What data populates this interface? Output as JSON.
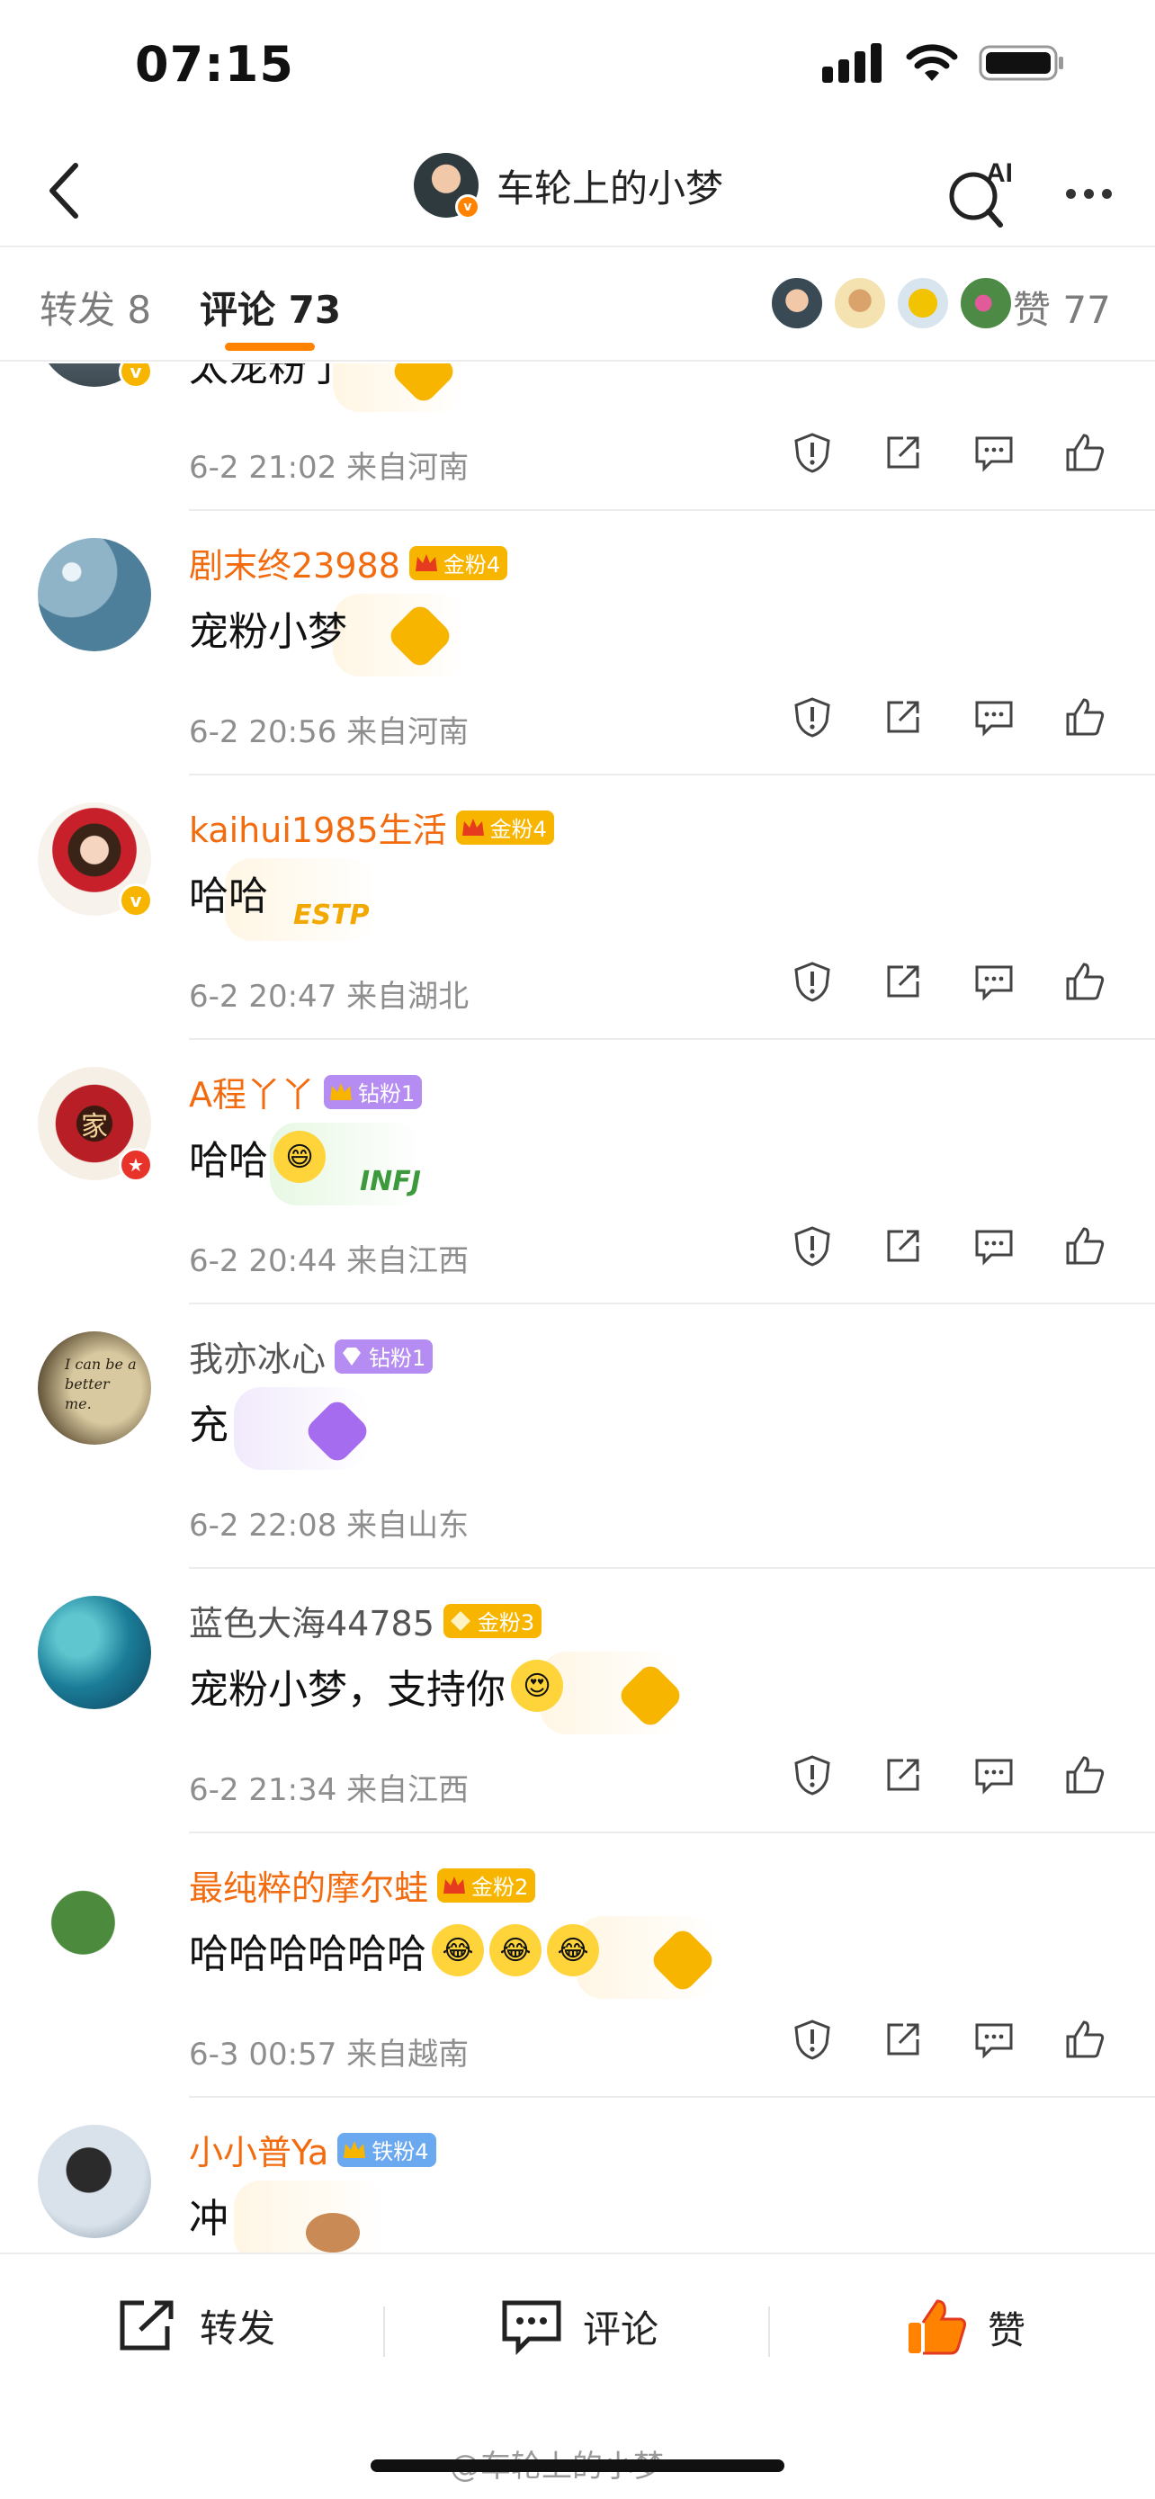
{
  "status_bar": {
    "time": "07:15"
  },
  "nav": {
    "title": "车轮上的小梦",
    "ai_label": "AI"
  },
  "tabs": {
    "repost": "转发 8",
    "comments": "评论 73",
    "likes": "赞 77"
  },
  "colors": {
    "accent": "#ff8200",
    "name_orange": "#f26b0f",
    "name_gray": "#555555",
    "gold_badge": "#f7b500",
    "diamond_badge": "#b58cf2",
    "iron_badge": "#6aa8f0",
    "meta_gray": "#8e8e8e"
  },
  "comments": [
    {
      "name": "",
      "text": "太宠粉了",
      "meta": "6-2 21:02  来自河南",
      "badge": "",
      "avatar": "partial-avatar"
    },
    {
      "name": "剧末终23988",
      "name_color": "orange",
      "badge": "金粉4",
      "badge_type": "gold",
      "text": "宠粉小梦",
      "meta": "6-2 20:56  来自河南",
      "avatar": "water-sparkle-avatar"
    },
    {
      "name": "kaihui1985生活",
      "name_color": "orange",
      "badge": "金粉4",
      "badge_type": "gold",
      "text": "哈哈",
      "deco_text": "ESTP",
      "meta": "6-2 20:47  来自湖北",
      "avatar": "cartoon-girl-avatar"
    },
    {
      "name": "A程丫丫",
      "name_color": "orange",
      "badge": "钻粉1",
      "badge_type": "diamond",
      "text": "哈哈",
      "emoji": "grin-emoji",
      "deco_text": "INFJ",
      "meta": "6-2 20:44  来自江西",
      "avatar": "chinese-knot-avatar",
      "avatar_text": "家"
    },
    {
      "name": "我亦冰心",
      "name_color": "gray",
      "badge": "钻粉1",
      "badge_type": "diamond",
      "text": "充",
      "meta": "6-2 22:08  来自山东",
      "avatar": "text-photo-avatar",
      "avatar_text": "I can be a better me."
    },
    {
      "name": "蓝色大海44785",
      "name_color": "gray",
      "badge": "金粉3",
      "badge_type": "gold",
      "text": "宠粉小梦，支持你",
      "emoji": "flower-emoji",
      "meta": "6-2 21:34  来自江西",
      "avatar": "blue-sea-avatar"
    },
    {
      "name": "最纯粹的摩尔蛙",
      "name_color": "orange",
      "badge": "金粉2",
      "badge_type": "gold",
      "text": "哈哈哈哈哈哈",
      "emoji_count": 3,
      "emoji": "tears-of-joy-emoji",
      "meta": "6-3 00:57  来自越南",
      "avatar": "frog-avatar"
    },
    {
      "name": "小小普Ya",
      "name_color": "orange",
      "badge": "铁粉4",
      "badge_type": "iron",
      "text": "冲",
      "meta": "",
      "avatar": "portrait-avatar"
    }
  ],
  "toolbar": {
    "repost": "转发",
    "comment": "评论",
    "like": "赞"
  },
  "watermark": "@车轮上的小梦"
}
